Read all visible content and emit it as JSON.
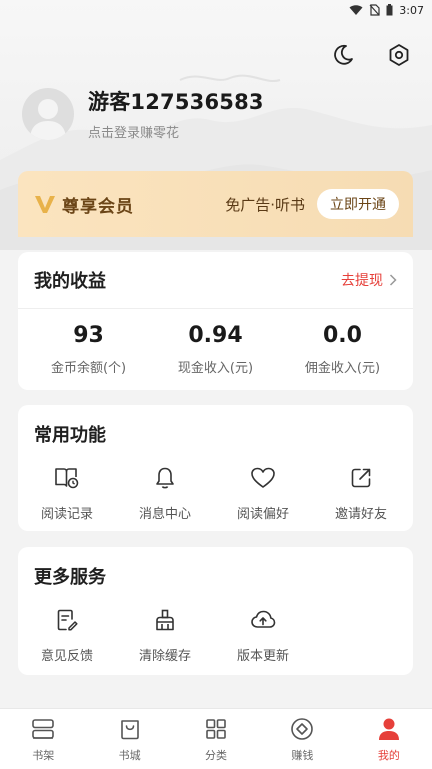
{
  "status_bar": {
    "time": "3:07"
  },
  "profile": {
    "name": "游客127536583",
    "subtitle": "点击登录赚零花"
  },
  "vip": {
    "title": "尊享会员",
    "promo": "免广告·听书",
    "button": "立即开通"
  },
  "earnings": {
    "title": "我的收益",
    "withdraw_label": "去提现",
    "stats": [
      {
        "value": "93",
        "label": "金币余额(个)"
      },
      {
        "value": "0.94",
        "label": "现金收入(元)"
      },
      {
        "value": "0.0",
        "label": "佣金收入(元)"
      }
    ]
  },
  "common_functions": {
    "title": "常用功能",
    "items": [
      {
        "label": "阅读记录",
        "icon": "book-history-icon"
      },
      {
        "label": "消息中心",
        "icon": "bell-icon"
      },
      {
        "label": "阅读偏好",
        "icon": "heart-icon"
      },
      {
        "label": "邀请好友",
        "icon": "share-icon"
      }
    ]
  },
  "more_services": {
    "title": "更多服务",
    "items": [
      {
        "label": "意见反馈",
        "icon": "feedback-icon"
      },
      {
        "label": "清除缓存",
        "icon": "broom-icon"
      },
      {
        "label": "版本更新",
        "icon": "cloud-upload-icon"
      }
    ]
  },
  "tabbar": {
    "items": [
      {
        "label": "书架",
        "icon": "bookshelf-icon"
      },
      {
        "label": "书城",
        "icon": "bookstore-icon"
      },
      {
        "label": "分类",
        "icon": "category-icon"
      },
      {
        "label": "赚钱",
        "icon": "coin-icon"
      },
      {
        "label": "我的",
        "icon": "user-icon",
        "active": true
      }
    ]
  },
  "colors": {
    "accent": "#e6403a",
    "vip_gold": "#f6dcb3",
    "vip_text": "#6b4517"
  }
}
